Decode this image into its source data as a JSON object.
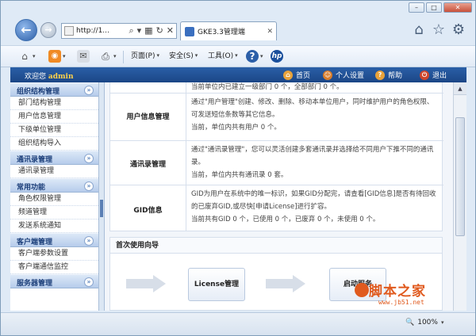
{
  "browser": {
    "address": "http://1...",
    "tab_title": "GKE3.3管理端",
    "commands": {
      "page": "页面(P)",
      "safety": "安全(S)",
      "tools": "工具(O)"
    },
    "zoom": "100%"
  },
  "header": {
    "welcome_prefix": "欢迎您",
    "username": "admin",
    "links": {
      "home": "首页",
      "personal_settings": "个人设置",
      "help": "帮助",
      "logout": "退出"
    }
  },
  "sidebar": {
    "groups": [
      {
        "title": "组织结构管理",
        "items": [
          "部门结构管理",
          "用户信息管理",
          "下级单位管理",
          "组织结构导入"
        ]
      },
      {
        "title": "通讯录管理",
        "items": [
          "通讯录管理"
        ]
      },
      {
        "title": "常用功能",
        "items": [
          "角色权限管理",
          "频道管理",
          "发送系统通知"
        ]
      },
      {
        "title": "客户端管理",
        "items": [
          "客户端参数设置",
          "客户端通信监控"
        ]
      },
      {
        "title": "服务器管理",
        "items": []
      }
    ]
  },
  "content": {
    "top_partial": "当前单位内已建立一级部门 0 个，全部部门 0 个。",
    "sections": [
      {
        "label": "用户信息管理",
        "desc": "通过\"用户管理\"创建、修改、删除、移动本单位用户，同时维护用户的角色权限、可发送短信条数等其它信息。",
        "stat": "当前，单位内共有用户 0 个。"
      },
      {
        "label": "通讯录管理",
        "desc": "通过\"通讯录管理\"，您可以灵活创建多套通讯录并选择给不同用户下推不同的通讯录。",
        "stat": "当前，单位内共有通讯录 0 套。"
      },
      {
        "label": "GID信息",
        "desc": "GID为用户在系统中的唯一标识，如果GID分配完，请查看[GID信息]是否有待回收的已废弃GID,或尽快[申请License]进行扩容。",
        "stat": "当前共有GID 0 个，已使用 0 个，已废弃 0 个，未使用 0 个。"
      }
    ],
    "wizard": {
      "title": "首次使用向导",
      "steps": [
        "License管理",
        "启动服务"
      ]
    }
  },
  "watermark": {
    "main": "脚本之家",
    "url": "www.jb51.net"
  },
  "colors": {
    "header_blue": "#1b4686",
    "accent_yellow": "#ffd24a",
    "watermark": "#e05a1e"
  }
}
